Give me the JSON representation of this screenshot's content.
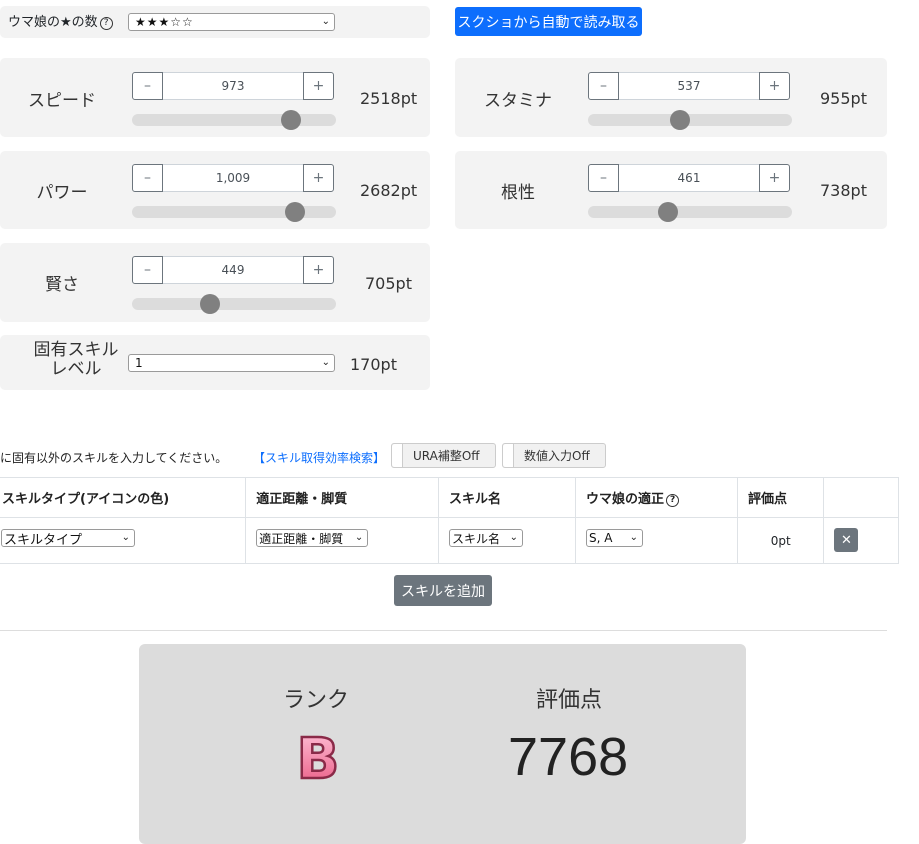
{
  "top": {
    "stars_label": "ウマ娘の★の数",
    "stars_value": "★★★☆☆",
    "screenshot_button": "スクショから自動で読み取る"
  },
  "stats": {
    "speed": {
      "label": "スピード",
      "value": "973",
      "pt": "2518pt",
      "fill": 0.78
    },
    "stamina": {
      "label": "スタミナ",
      "value": "537",
      "pt": "955pt",
      "fill": 0.45
    },
    "power": {
      "label": "パワー",
      "value": "1,009",
      "pt": "2682pt",
      "fill": 0.8
    },
    "guts": {
      "label": "根性",
      "value": "461",
      "pt": "738pt",
      "fill": 0.39
    },
    "wisdom": {
      "label": "賢さ",
      "value": "449",
      "pt": "705pt",
      "fill": 0.38
    }
  },
  "stepper": {
    "minus": "–",
    "plus": "+"
  },
  "unique_skill": {
    "label_line1": "固有スキル",
    "label_line2": "レベル",
    "value": "1",
    "pt": "170pt"
  },
  "skills": {
    "instruction": "に固有以外のスキルを入力してください。",
    "search_link": "【スキル取得効率検索】",
    "ura_toggle": "URA補整Off",
    "number_toggle": "数値入力Off",
    "headers": [
      "スキルタイプ(アイコンの色)",
      "適正距離・脚質",
      "スキル名",
      "ウマ娘の適正",
      "評価点",
      ""
    ],
    "row": {
      "type": "スキルタイプ",
      "distance": "適正距離・脚質",
      "name": "スキル名",
      "aptitude": "S, A",
      "score": "0pt",
      "delete": "✕"
    },
    "add_button": "スキルを追加"
  },
  "result": {
    "rank_label": "ランク",
    "rank_value": "B",
    "score_label": "評価点",
    "score_value": "7768"
  }
}
